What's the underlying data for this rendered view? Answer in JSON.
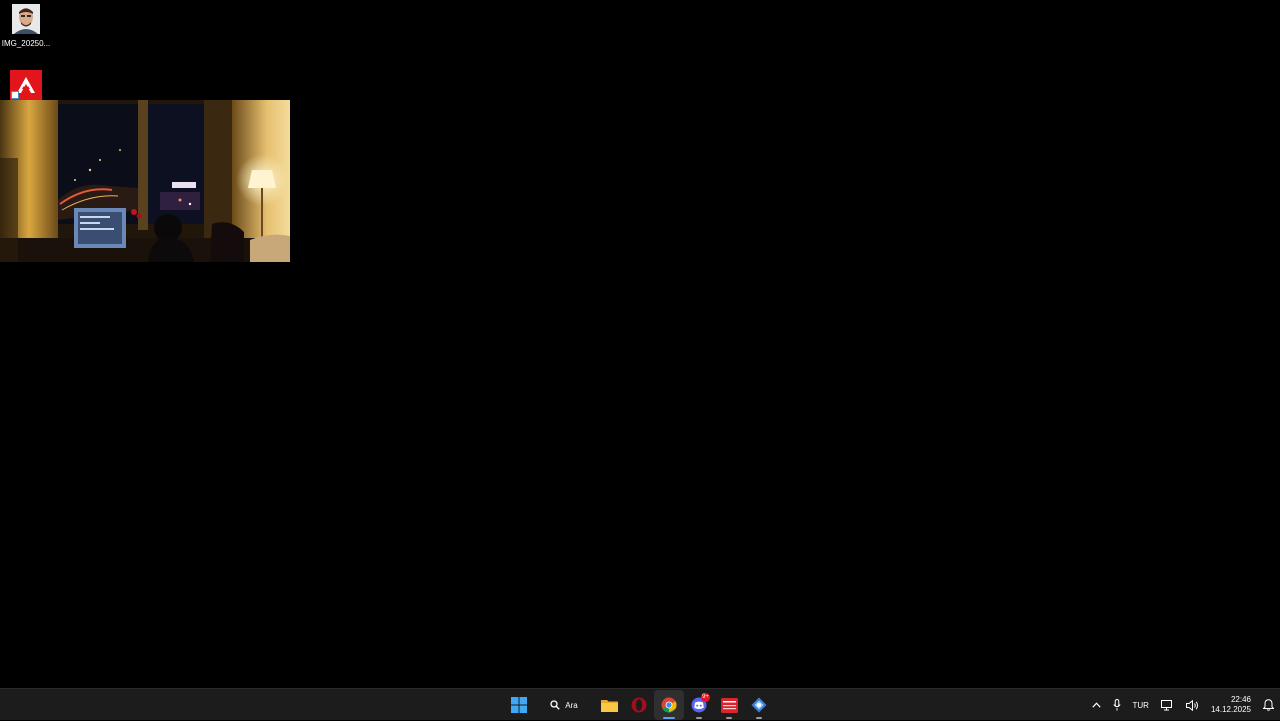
{
  "desktop": {
    "icons": [
      {
        "label": "IMG_20250...",
        "icon": "photo-thumbnail-icon"
      },
      {
        "label": "",
        "icon": "adobe-acrobat-icon"
      }
    ],
    "video_window": {
      "content": "video-frame"
    }
  },
  "taskbar": {
    "start": {
      "icon": "windows-start-icon"
    },
    "search": {
      "label": "Ara",
      "icon": "search-icon"
    },
    "apps": [
      {
        "icon": "file-explorer-icon",
        "running": false
      },
      {
        "icon": "opera-icon",
        "running": false
      },
      {
        "icon": "chrome-icon",
        "running": true,
        "active": true
      },
      {
        "icon": "discord-icon",
        "running": true,
        "badge": "9+"
      },
      {
        "icon": "video-editor-icon",
        "running": true
      },
      {
        "icon": "app-settings-icon",
        "running": true
      }
    ],
    "tray": {
      "overflow_icon": "chevron-up-icon",
      "mic_icon": "microphone-icon",
      "language": "TUR",
      "network_icon": "network-icon",
      "volume_icon": "volume-icon",
      "time": "22:46",
      "date": "14.12.2025",
      "notification_icon": "notification-icon"
    }
  },
  "colors": {
    "desktop_bg": "#000000",
    "taskbar_bg": "#1c1c1c",
    "accent": "#5ea0ef",
    "adobe_red": "#e1151a",
    "badge_red": "#e81123"
  }
}
